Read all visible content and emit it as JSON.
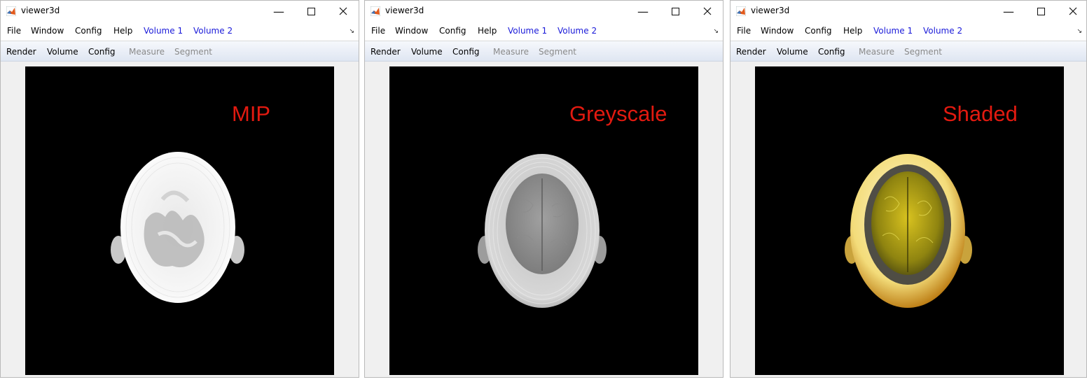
{
  "windows": [
    {
      "title": "viewer3d",
      "menu": [
        "File",
        "Window",
        "Config",
        "Help"
      ],
      "volume_menu": [
        "Volume 1",
        "Volume 2"
      ],
      "toolbar_active": [
        "Render",
        "Volume",
        "Config"
      ],
      "toolbar_disabled": [
        "Measure",
        "Segment"
      ],
      "render_label": "MIP",
      "render_mode": "mip"
    },
    {
      "title": "viewer3d",
      "menu": [
        "File",
        "Window",
        "Config",
        "Help"
      ],
      "volume_menu": [
        "Volume 1",
        "Volume 2"
      ],
      "toolbar_active": [
        "Render",
        "Volume",
        "Config"
      ],
      "toolbar_disabled": [
        "Measure",
        "Segment"
      ],
      "render_label": "Greyscale",
      "render_mode": "greyscale"
    },
    {
      "title": "viewer3d",
      "menu": [
        "File",
        "Window",
        "Config",
        "Help"
      ],
      "volume_menu": [
        "Volume 1",
        "Volume 2"
      ],
      "toolbar_active": [
        "Render",
        "Volume",
        "Config"
      ],
      "toolbar_disabled": [
        "Measure",
        "Segment"
      ],
      "render_label": "Shaded",
      "render_mode": "shaded"
    }
  ],
  "colors": {
    "label_red": "#e21a10",
    "menu_blue": "#1a1ad9",
    "viewport_bg": "#000000"
  },
  "icons": [
    "matlab-icon",
    "minimize-icon",
    "maximize-icon",
    "close-icon",
    "menu-arrow-icon"
  ]
}
